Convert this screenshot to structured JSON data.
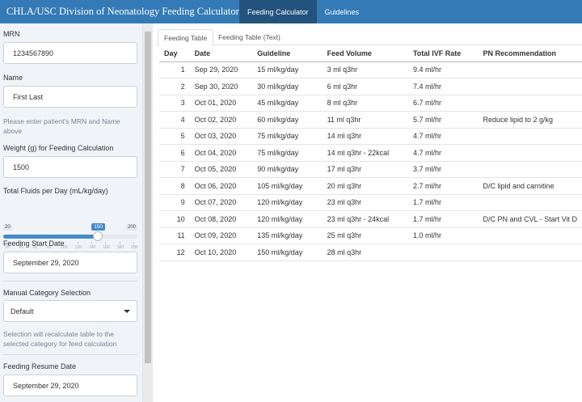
{
  "app": {
    "title": "CHLA/USC Division of Neonatology Feeding Calculator",
    "nav": [
      {
        "label": "Feeding Calculator",
        "active": true
      },
      {
        "label": "Guidelines",
        "active": false
      }
    ]
  },
  "sidebar": {
    "mrn_label": "MRN",
    "mrn_value": "1234567890",
    "name_label": "Name",
    "name_value": "First Last",
    "help_mrn": "Please enter patient's MRN and Name above",
    "weight_label": "Weight (g) for Feeding Calculation",
    "weight_value": "1500",
    "fluids_label": "Total Fluids per Day (mL/kg/day)",
    "fluids_slider": {
      "min": "20",
      "max": "200",
      "value": "150",
      "fraction": 0.722,
      "grid": [
        "20",
        "40",
        "60",
        "80",
        "100",
        "120",
        "140",
        "160",
        "180",
        "200"
      ]
    },
    "start_date_label": "Feeding Start Date",
    "start_date_value": "September 29, 2020",
    "category_label": "Manual Category Selection",
    "category_value": "Default",
    "help_category": "Selection will recalculate table to the selected category for feed calculation",
    "resume_date_label": "Feeding Resume Date",
    "resume_date_value": "September 29, 2020"
  },
  "main": {
    "tabs": [
      {
        "label": "Feeding Table",
        "active": true
      },
      {
        "label": "Feeding Table (Text)",
        "active": false
      }
    ],
    "table": {
      "headers": [
        "Day",
        "Date",
        "Guideline",
        "Feed Volume",
        "Total IVF Rate",
        "PN Recommendation"
      ],
      "rows": [
        [
          "1",
          "Sep 29, 2020",
          "15 ml/kg/day",
          "3 ml q3hr",
          "9.4 ml/hr",
          ""
        ],
        [
          "2",
          "Sep 30, 2020",
          "30 ml/kg/day",
          "6 ml q3hr",
          "7.4 ml/hr",
          ""
        ],
        [
          "3",
          "Oct 01, 2020",
          "45 ml/kg/day",
          "8 ml q3hr",
          "6.7 ml/hr",
          ""
        ],
        [
          "4",
          "Oct 02, 2020",
          "60 ml/kg/day",
          "11 ml q3hr",
          "5.7 ml/hr",
          "Reduce lipid to 2 g/kg"
        ],
        [
          "5",
          "Oct 03, 2020",
          "75 ml/kg/day",
          "14 ml q3hr",
          "4.7 ml/hr",
          ""
        ],
        [
          "6",
          "Oct 04, 2020",
          "75 ml/kg/day",
          "14 ml q3hr - 22kcal",
          "4.7 ml/hr",
          ""
        ],
        [
          "7",
          "Oct 05, 2020",
          "90 ml/kg/day",
          "17 ml q3hr",
          "3.7 ml/hr",
          ""
        ],
        [
          "8",
          "Oct 06, 2020",
          "105 ml/kg/day",
          "20 ml q3hr",
          "2.7 ml/hr",
          "D/C lipid and carnitine"
        ],
        [
          "9",
          "Oct 07, 2020",
          "120 ml/kg/day",
          "23 ml q3hr",
          "1.7 ml/hr",
          ""
        ],
        [
          "10",
          "Oct 08, 2020",
          "120 ml/kg/day",
          "23 ml q3hr - 24kcal",
          "1.7 ml/hr",
          "D/C PN and CVL - Start Vit D"
        ],
        [
          "11",
          "Oct 09, 2020",
          "135 ml/kg/day",
          "25 ml q3hr",
          "1.0 ml/hr",
          ""
        ],
        [
          "12",
          "Oct 10, 2020",
          "150 ml/kg/day",
          "28 ml q3hr",
          "",
          ""
        ]
      ]
    }
  },
  "colors": {
    "navbar": "#337ab7",
    "nav_active": "#23527c",
    "sidebar_bg": "#f0f3f8",
    "slider_accent": "#428bca"
  }
}
